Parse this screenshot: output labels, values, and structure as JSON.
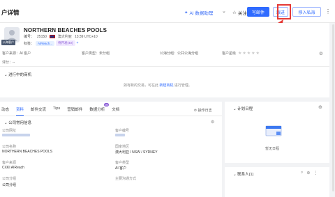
{
  "header": {
    "title": "户详情",
    "ai_label": "AI 数据助理",
    "follow_label": "关注",
    "primary_btn": "写邮件",
    "followup_btn": "跟进",
    "mark_btn": "移入私海"
  },
  "company": {
    "name": "NORTHERN BEACHES POOLS",
    "id_label": "编号：",
    "id": "25150",
    "country": "澳大利亚",
    "time": "13:39 UTC+10",
    "tags_label": "标签：",
    "tags": [
      "AIReach...",
      "待开发(40)"
    ],
    "avatar_tag": "公海客户"
  },
  "fields": {
    "source_label": "客户来源：AI 客户",
    "type_label": "客户类型：未分组",
    "group_label": "公海分组：公共公海分组",
    "star_label": "客户星级",
    "rating_label": "评分：--"
  },
  "opportunity": {
    "title": "进行中的商机",
    "empty_pre": "如有新的交易，可在此",
    "empty_link": "新建商机",
    "empty_post": "进行管理。"
  },
  "tabs": [
    {
      "label": "动态"
    },
    {
      "label": "资料"
    },
    {
      "label": "邮件交流"
    },
    {
      "label": "Tips"
    },
    {
      "label": "营销邮件"
    },
    {
      "label": "数据分析",
      "badge": "99"
    },
    {
      "label": "文档"
    }
  ],
  "op_log": "操作日志",
  "detail": {
    "section_title": "公司常用信息",
    "left": [
      {
        "label": "公司网址",
        "value": ""
      },
      {
        "label": "公司名称",
        "value": "NORTHERN BEACHES POOLS"
      },
      {
        "label": "客户来源",
        "value": "CXKI AIReach"
      },
      {
        "label": "公司分组",
        "value": "公司分组"
      }
    ],
    "right": [
      {
        "label": "客户编号",
        "value": ""
      },
      {
        "label": "国家地区",
        "value": "澳大利亚 / NSW / SYDNEY"
      },
      {
        "label": "客户类型",
        "value": "AI 客户"
      },
      {
        "label": "主要沟通方式",
        "value": ""
      }
    ]
  },
  "plan": {
    "title": "计划日程",
    "empty": "暂无日程"
  },
  "contacts": {
    "title": "联系人(1)"
  },
  "icons": [
    "back-icon",
    "star-icon",
    "gear-icon",
    "plus-icon",
    "search-icon",
    "more-icon",
    "calendar-icon"
  ],
  "colors": {
    "primary": "#2f6bff",
    "highlight": "#e53935",
    "tag_purple": "#8a5cd6"
  }
}
